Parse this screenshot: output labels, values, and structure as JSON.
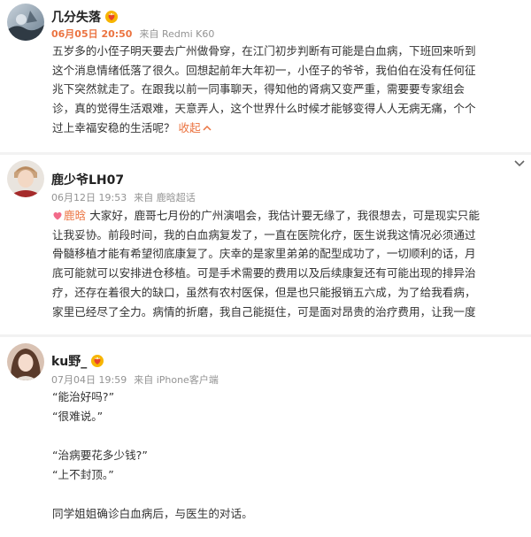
{
  "posts": [
    {
      "username": "几分失落",
      "date": "06月05日 20:50",
      "source": "来自 Redmi K60",
      "lines": [
        "五岁多的小侄子明天要去广州做骨穿，在江门初步判断有可能是白血病，下班回来听到",
        "这个消息情绪低落了很久。回想起前年大年初一，小侄子的爷爷，我伯伯在没有任何征",
        "兆下突然就走了。在跟我以前一同事聊天，得知他的肾病又变严重，需要要专家组会",
        "诊，真的觉得生活艰难，天意弄人，这个世界什么时候才能够变得人人无病无痛，个个",
        "过上幸福安稳的生活呢？"
      ],
      "collapse_label": "收起"
    },
    {
      "username": "鹿少爷LH07",
      "date": "06月12日 19:53",
      "source": "来自 鹿晗超话",
      "topic": "鹿晗",
      "lines": [
        "大家好，鹿哥七月份的广州演唱会，我估计要无缘了，我很想去，可是现实只能",
        "让我妥协。前段时间，我的白血病复发了，一直在医院化疗，医生说我这情况必须通过",
        "骨髓移植才能有希望彻底康复了。庆幸的是家里弟弟的配型成功了，一切顺利的话，月",
        "底可能就可以安排进仓移植。可是手术需要的费用以及后续康复还有可能出现的排异治",
        "疗，还存在着很大的缺口，虽然有农村医保，但是也只能报销五六成，为了给我看病，",
        "家里已经尽了全力。病情的折磨，我自己能挺住，可是面对昂贵的治疗费用，让我一度"
      ]
    },
    {
      "username": "ku野_",
      "date": "07月04日 19:59",
      "source": "来自 iPhone客户端",
      "lines": [
        "“能治好吗?”",
        "“很难说。”",
        "",
        "“治病要花多少钱?”",
        "“上不封顶。”",
        "",
        "同学姐姐确诊白血病后，与医生的对话。"
      ]
    }
  ],
  "colors": {
    "accent": "#eb7340",
    "meta": "#939393",
    "text": "#333333"
  },
  "icons": {
    "badge": "crowned-heart-badge-icon",
    "chevron": "chevron-down-icon",
    "collapse": "chevron-up-icon",
    "topic": "heart-topic-icon"
  }
}
